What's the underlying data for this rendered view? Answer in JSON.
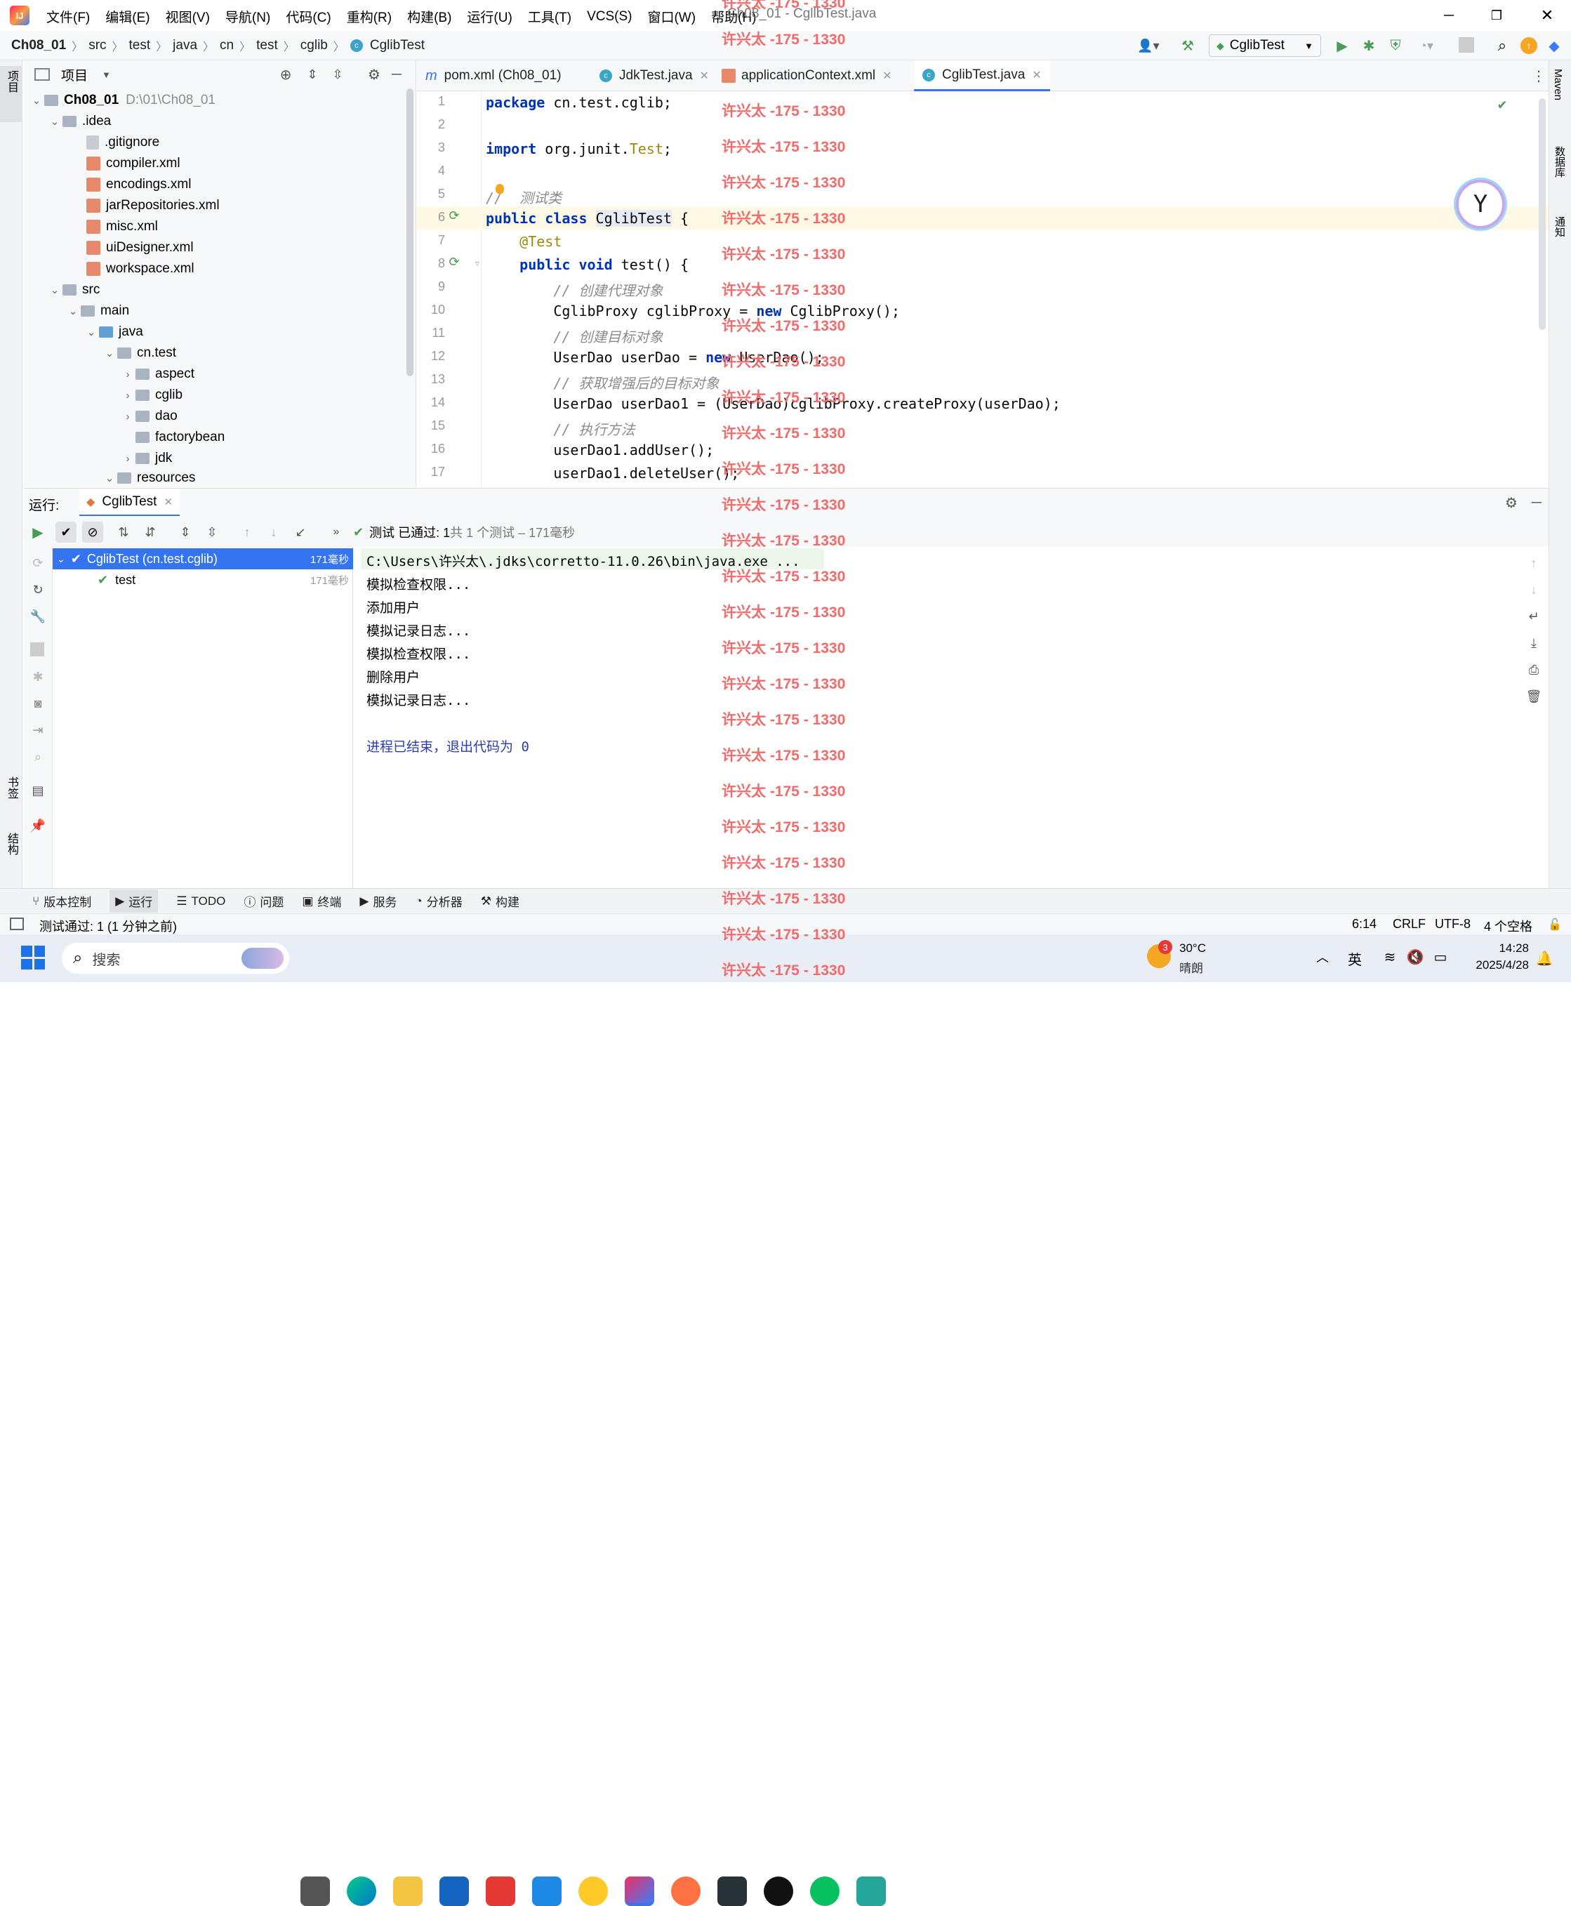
{
  "window": {
    "title": "Ch08_01 - CgllbTest.java",
    "menu": [
      "文件(F)",
      "编辑(E)",
      "视图(V)",
      "导航(N)",
      "代码(C)",
      "重构(R)",
      "构建(B)",
      "运行(U)",
      "工具(T)",
      "VCS(S)",
      "窗口(W)",
      "帮助(H)"
    ]
  },
  "breadcrumb": [
    "Ch08_01",
    "src",
    "test",
    "java",
    "cn",
    "test",
    "cglib",
    "CglibTest"
  ],
  "run_config": "CglibTest",
  "project_panel": {
    "title": "项目",
    "items": [
      {
        "label": "Ch08_01",
        "path": "D:\\01\\Ch08_01"
      },
      {
        "label": ".idea"
      },
      {
        "label": ".gitignore"
      },
      {
        "label": "compiler.xml"
      },
      {
        "label": "encodings.xml"
      },
      {
        "label": "jarRepositories.xml"
      },
      {
        "label": "misc.xml"
      },
      {
        "label": "uiDesigner.xml"
      },
      {
        "label": "workspace.xml"
      },
      {
        "label": "src"
      },
      {
        "label": "main"
      },
      {
        "label": "java"
      },
      {
        "label": "cn.test"
      },
      {
        "label": "aspect"
      },
      {
        "label": "cglib"
      },
      {
        "label": "dao"
      },
      {
        "label": "factorybean"
      },
      {
        "label": "jdk"
      },
      {
        "label": "resources"
      }
    ]
  },
  "editor": {
    "tabs": [
      "pom.xml (Ch08_01)",
      "JdkTest.java",
      "applicationContext.xml",
      "CglibTest.java"
    ],
    "line_numbers": [
      "1",
      "2",
      "3",
      "4",
      "5",
      "6",
      "7",
      "8",
      "9",
      "10",
      "11",
      "12",
      "13",
      "14",
      "15",
      "16",
      "17"
    ]
  },
  "left_strip": {
    "project": "项目",
    "bookmarks": "书签",
    "structure": "结构"
  },
  "right_strip": {
    "maven": "Maven",
    "database": "数据库",
    "notifications": "通知"
  },
  "run_panel": {
    "label": "运行:",
    "tab": "CglibTest",
    "result": "测试 已通过: 1",
    "result_detail": "共 1 个测试 – 171毫秒",
    "tree": [
      {
        "label": "CglibTest (cn.test.cglib)",
        "time": "171毫秒"
      },
      {
        "label": "test",
        "time": "171毫秒"
      }
    ],
    "console": [
      "C:\\Users\\许兴太\\.jdks\\corretto-11.0.26\\bin\\java.exe ...",
      "模拟检查权限...",
      "添加用户",
      "模拟记录日志...",
      "模拟检查权限...",
      "删除用户",
      "模拟记录日志...",
      "",
      "进程已结束，退出代码为 0"
    ]
  },
  "bottom_tools": [
    "版本控制",
    "运行",
    "TODO",
    "问题",
    "终端",
    "服务",
    "分析器",
    "构建"
  ],
  "status": {
    "message": "测试通过: 1 (1 分钟之前)",
    "position": "6:14",
    "line_ending": "CRLF",
    "encoding": "UTF-8",
    "indent": "4 个空格"
  },
  "taskbar": {
    "search": "搜索",
    "weather_temp": "30°C",
    "weather_desc": "晴朗",
    "weather_badge": "3",
    "ime": "英",
    "time": "14:28",
    "date": "2025/4/28"
  },
  "watermark": "许兴太 -175 - 1330",
  "colors": {
    "accent": "#3574f0",
    "watermark": "#f26b6b",
    "pass": "#499c54"
  }
}
